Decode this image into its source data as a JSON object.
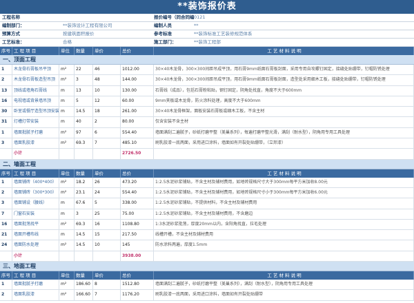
{
  "title": "**装饰报价表",
  "meta": [
    {
      "label1": "工程名称",
      "value1": "",
      "label2": "报价编号（同合同编号）",
      "value2": "0121"
    },
    {
      "label1": "编制部门：",
      "value1": "**装饰设计工程有限公司",
      "label2": "编制人员",
      "value2": "**"
    },
    {
      "label1": "预算方式",
      "value1": "按建筑面积报价",
      "label2": "参考标准",
      "value2": "**装饰标准工艺装修规范体系"
    },
    {
      "label1": "工艺标准：",
      "value1": "合格",
      "label2": "施工部门：",
      "value2": "**装饰工程部"
    }
  ],
  "columns": {
    "no": "序号",
    "item": "工 程 项 目",
    "unit": "单位",
    "qty": "数量",
    "price": "单价",
    "total": "总价",
    "desc": "工 艺 材 料 说 明"
  },
  "sections": [
    {
      "title": "一、顶面工程",
      "rows": [
        {
          "no": "1",
          "item": "木龙骨石膏板吊平顶",
          "unit": "m²",
          "qty": "22",
          "price": "46",
          "total": "1012.00",
          "desc": "30×40木龙骨，300×300间距吊成平顶，用石膏9mm纸面石膏板封面，采用专用自攻螺钉固定，接缝处贴绷带，钉帽防锈处理"
        },
        {
          "no": "2",
          "item": "木龙骨石膏板造型吊顶",
          "unit": "m²",
          "qty": "3",
          "price": "48",
          "total": "144.00",
          "desc": "30×40木龙骨，300×300间距吊成平顶，用石膏9mm纸面石膏板封面，造型处采用细木工板，接缝处贴绷带，钉帽防锈处理"
        },
        {
          "no": "13",
          "item": "顶线或墙角石膏线",
          "unit": "m",
          "qty": "13",
          "price": "10",
          "total": "130.00",
          "desc": "石膏线（成品），包括石膏粉粘贴，钢钉固定，阴角处找直，角度不大于600mm"
        },
        {
          "no": "16",
          "item": "电视墙或背景墙吊顶",
          "unit": "m",
          "qty": "5",
          "price": "12",
          "total": "60.00",
          "desc": "9mm夹板或木龙骨，防火涂料处理，高度不大于600mm"
        },
        {
          "no": "30",
          "item": "卧室或餐厅造型吊顶安装",
          "unit": "m",
          "qty": "14.5",
          "price": "18",
          "total": "261.00",
          "desc": "30×40木龙骨框架，面板安装石膏板或细木工板，不含主材"
        },
        {
          "no": "31",
          "item": "灯槽灯带安装",
          "unit": "m",
          "qty": "40",
          "price": "2",
          "total": "80.00",
          "desc": "仅含安装不含主材"
        },
        {
          "no": "1",
          "item": "墙面批腻子打磨",
          "unit": "m²",
          "qty": "97",
          "price": "6",
          "total": "554.40",
          "desc": "墙面满刮二遍腻子，砂纸打磨平整（美巢系列），每遍打磨平整光滑，满刮（耐水型），阴角用专用工具处理"
        },
        {
          "no": "3",
          "item": "墙面乳胶漆",
          "unit": "m²",
          "qty": "69.3",
          "price": "7",
          "total": "485.10",
          "desc": "刷乳胶漆一底两面，采用进口涂料，墙面如有开裂处贴绷带，（立邦漆）"
        }
      ],
      "subtotal": {
        "item": "小计",
        "total": "2726.50"
      }
    },
    {
      "title": "二、墙面工程",
      "rows": [
        {
          "no": "1",
          "item": "墙面铺砖（400*400）",
          "unit": "m²",
          "qty": "18.2",
          "price": "26",
          "total": "473.20",
          "desc": "1:2.5水泥砂浆铺贴，不含主材及辅材费用，如地砖规格尺寸大于300mm每平方米加收8.00元"
        },
        {
          "no": "2",
          "item": "墙面铺砖（300*300）",
          "unit": "m²",
          "qty": "23.1",
          "price": "24",
          "total": "554.40",
          "desc": "1:2.5水泥砂浆铺贴，不含主材及辅材费用，如地砖规格尺寸小于300mm每平方米加收6.00元"
        },
        {
          "no": "3",
          "item": "墙面铺设（腰线）",
          "unit": "m",
          "qty": "67.6",
          "price": "5",
          "total": "338.00",
          "desc": "1:2.5水泥砂浆铺贴，不提供材料，不含主材及辅材费用"
        },
        {
          "no": "7",
          "item": "门窗石安装",
          "unit": "m",
          "qty": "3",
          "price": "25",
          "total": "75.00",
          "desc": "1:2.5水泥砂浆铺贴，不含主材及辅材费用，不含磨边"
        },
        {
          "no": "16",
          "item": "墙面批荡找平",
          "unit": "m²",
          "qty": "69.3",
          "price": "16",
          "total": "1108.80",
          "desc": "1:3水泥砂浆批荡，厚度20mm以内，含阳角找直，拉毛处理"
        },
        {
          "no": "21",
          "item": "墙面开槽布线",
          "unit": "m",
          "qty": "14.5",
          "price": "15",
          "total": "217.50",
          "desc": "线槽开槽，不含主材及辅材费用"
        },
        {
          "no": "24",
          "item": "墙面防水处理",
          "unit": "m²",
          "qty": "14.5",
          "price": "10",
          "total": "145",
          "desc": "防水涂料两遍，厚度1.5mm"
        }
      ],
      "subtotal": {
        "item": "小计",
        "total": "3938.00"
      }
    },
    {
      "title": "三、地面工程",
      "rows": [
        {
          "no": "1",
          "item": "墙面批腻子打磨",
          "unit": "m²",
          "qty": "186.60",
          "price": "8",
          "total": "1512.80",
          "desc": "墙面满刮二遍腻子，砂纸打磨平整（美巢系列），满刮（耐水型），阴角用专用工具处理"
        },
        {
          "no": "2",
          "item": "墙面乳胶漆",
          "unit": "m²",
          "qty": "166.60",
          "price": "7",
          "total": "1176.20",
          "desc": "刷乳胶漆一底两面，采用进口涂料，墙面如有开裂处贴绷带"
        }
      ]
    }
  ]
}
